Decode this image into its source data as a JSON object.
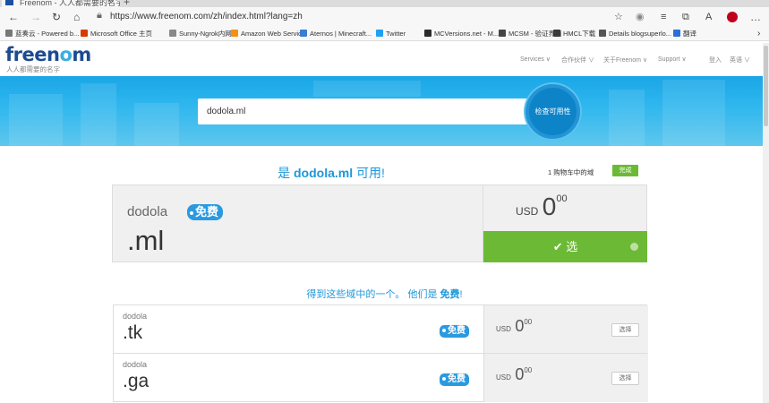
{
  "browser": {
    "tab_title": "Freenom - 人人都需要的名字",
    "tab_close": "✕",
    "new_tab": "+",
    "address": "https://www.freenom.com/zh/index.html?lang=zh",
    "bookmarks": [
      {
        "label": "蓝奏云 - Powered b...",
        "color": "#777777"
      },
      {
        "label": "Microsoft Office 主页",
        "color": "#d83b01"
      },
      {
        "label": "Sunny-Ngrok内网...",
        "color": "#888888"
      },
      {
        "label": "Amazon Web Servic...",
        "color": "#f29111"
      },
      {
        "label": "Aternos | Minecraft...",
        "color": "#3a7bd5"
      },
      {
        "label": "Twitter",
        "color": "#1da1f2"
      },
      {
        "label": "MCVersions.net - M...",
        "color": "#2b2b2b"
      },
      {
        "label": "MCSM - 验证界面",
        "color": "#444444"
      },
      {
        "label": "HMCL下载",
        "color": "#3a3a3a"
      },
      {
        "label": "Details blogsuperlo...",
        "color": "#555555"
      },
      {
        "label": "翻译",
        "color": "#2b6fd6"
      }
    ]
  },
  "site": {
    "logo_a": "freen",
    "logo_o": "o",
    "logo_b": "m",
    "slogan": "人人都需要的名字",
    "nav": [
      "Services ∨",
      "合作伙伴 ∨",
      "关于Freenom ∨",
      "Support ∨",
      "登入",
      "英语 ∨"
    ]
  },
  "search": {
    "value": "dodola.ml",
    "button": "检查可用性"
  },
  "result": {
    "headline_prefix": "是 ",
    "headline_domain": "dodola.ml",
    "headline_suffix": " 可用!",
    "cart_text": "1 购物车中的域",
    "done_button": "完成",
    "name": "dodola",
    "badge": "免费",
    "tld": ".ml",
    "currency": "USD",
    "price_int": "0",
    "price_dec": "00",
    "select_label": "✔ 选"
  },
  "suggestions": {
    "heading_prefix": "得到这些域中的一个。 他们是 ",
    "heading_bold": "免费",
    "heading_suffix": "!",
    "items": [
      {
        "name": "dodola",
        "tld": ".tk",
        "badge": "免费",
        "currency": "USD",
        "price_int": "0",
        "price_dec": "00",
        "button": "选择"
      },
      {
        "name": "dodola",
        "tld": ".ga",
        "badge": "免费",
        "currency": "USD",
        "price_int": "0",
        "price_dec": "00",
        "button": "选择"
      }
    ]
  },
  "colors": {
    "brand_blue": "#1d97d9",
    "green": "#6cb936",
    "badge_blue": "#2a9ae0"
  }
}
